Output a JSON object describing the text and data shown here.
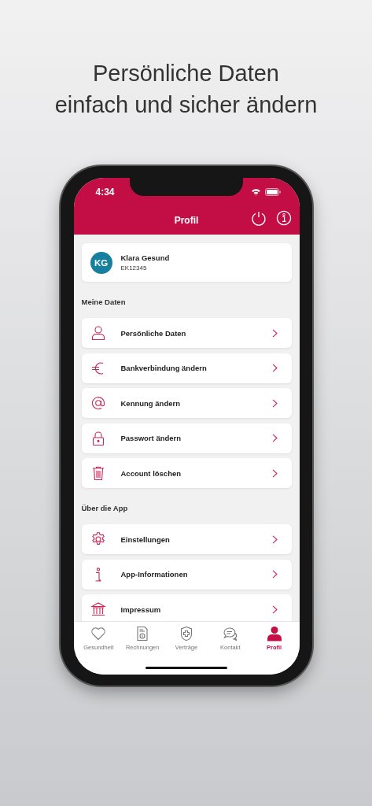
{
  "headline": [
    "Persönliche Daten",
    "einfach und sicher ändern"
  ],
  "status_bar": {
    "time": "4:34"
  },
  "header": {
    "title": "Profil"
  },
  "profile": {
    "initials": "KG",
    "name": "Klara Gesund",
    "id": "EK12345"
  },
  "sections": [
    {
      "title": "Meine Daten",
      "items": [
        {
          "label": "Persönliche Daten"
        },
        {
          "label": "Bankverbindung ändern"
        },
        {
          "label": "Kennung ändern"
        },
        {
          "label": "Passwort ändern"
        },
        {
          "label": "Account löschen"
        }
      ]
    },
    {
      "title": "Über die App",
      "items": [
        {
          "label": "Einstellungen"
        },
        {
          "label": "App-Informationen"
        },
        {
          "label": "Impressum"
        }
      ]
    }
  ],
  "tabs": [
    {
      "label": "Gesundheit",
      "selected": false
    },
    {
      "label": "Rechnungen",
      "selected": false
    },
    {
      "label": "Verträge",
      "selected": false
    },
    {
      "label": "Kontakt",
      "selected": false
    },
    {
      "label": "Profil",
      "selected": true
    }
  ]
}
